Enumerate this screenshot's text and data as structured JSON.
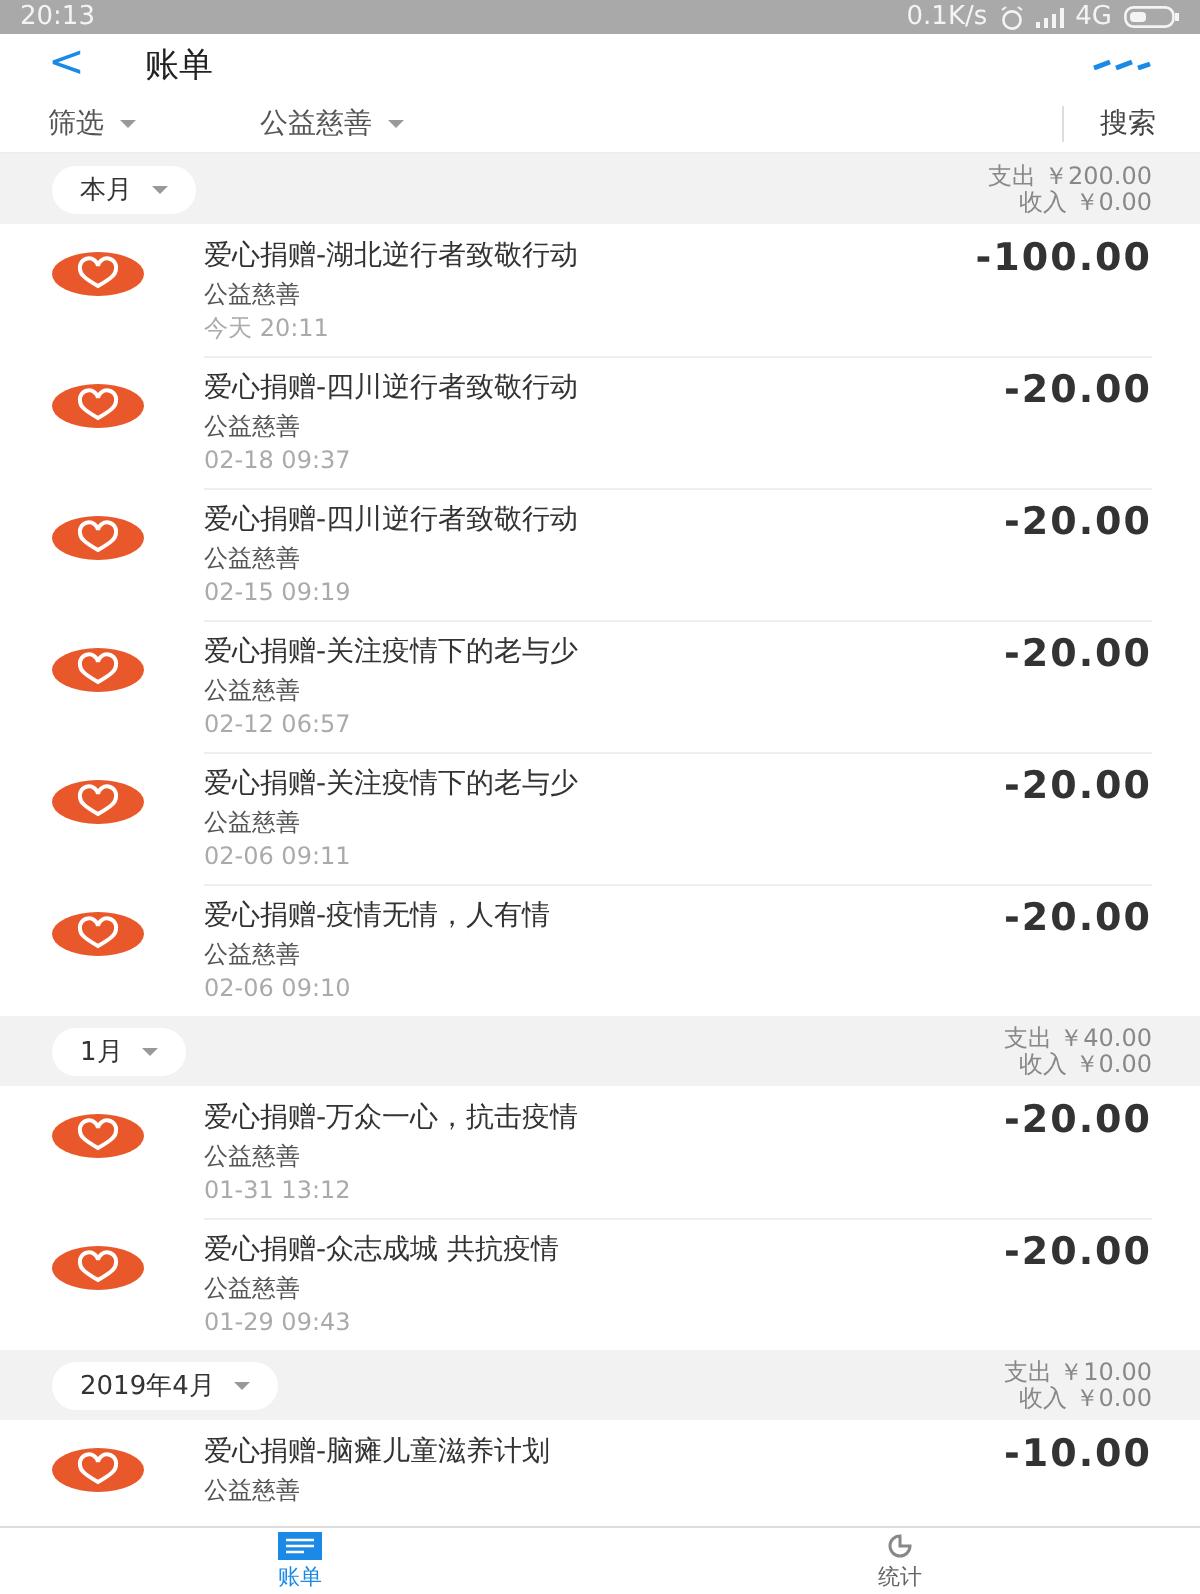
{
  "status_bar": {
    "time": "20:13",
    "speed": "0.1K/s",
    "network": "4G"
  },
  "header": {
    "back": "<",
    "title": "账单"
  },
  "filters": [
    {
      "label": "筛选"
    },
    {
      "label": "公益慈善"
    }
  ],
  "search": "搜索",
  "sections": [
    {
      "month": "本月",
      "expense": "支出 ￥200.00",
      "income": "收入 ￥0.00",
      "items": [
        {
          "title": "爱心捐赠-湖北逆行者致敬行动",
          "category": "公益慈善",
          "time": "今天  20:11",
          "amount": "-100.00"
        },
        {
          "title": "爱心捐赠-四川逆行者致敬行动",
          "category": "公益慈善",
          "time": "02-18  09:37",
          "amount": "-20.00"
        },
        {
          "title": "爱心捐赠-四川逆行者致敬行动",
          "category": "公益慈善",
          "time": "02-15  09:19",
          "amount": "-20.00"
        },
        {
          "title": "爱心捐赠-关注疫情下的老与少",
          "category": "公益慈善",
          "time": "02-12  06:57",
          "amount": "-20.00"
        },
        {
          "title": "爱心捐赠-关注疫情下的老与少",
          "category": "公益慈善",
          "time": "02-06  09:11",
          "amount": "-20.00"
        },
        {
          "title": "爱心捐赠-疫情无情，人有情",
          "category": "公益慈善",
          "time": "02-06  09:10",
          "amount": "-20.00"
        }
      ]
    },
    {
      "month": "1月",
      "expense": "支出 ￥40.00",
      "income": "收入 ￥0.00",
      "items": [
        {
          "title": "爱心捐赠-万众一心，抗击疫情",
          "category": "公益慈善",
          "time": "01-31  13:12",
          "amount": "-20.00"
        },
        {
          "title": "爱心捐赠-众志成城 共抗疫情",
          "category": "公益慈善",
          "time": "01-29  09:43",
          "amount": "-20.00"
        }
      ]
    },
    {
      "month": "2019年4月",
      "expense": "支出 ￥10.00",
      "income": "收入 ￥0.00",
      "items": [
        {
          "title": "爱心捐赠-脑瘫儿童滋养计划",
          "category": "公益慈善",
          "amount": "-10.00"
        }
      ]
    }
  ],
  "tabs": [
    {
      "label": "账单",
      "kind": "list",
      "selected": true
    },
    {
      "label": "统计",
      "kind": "stats",
      "selected": false
    }
  ]
}
